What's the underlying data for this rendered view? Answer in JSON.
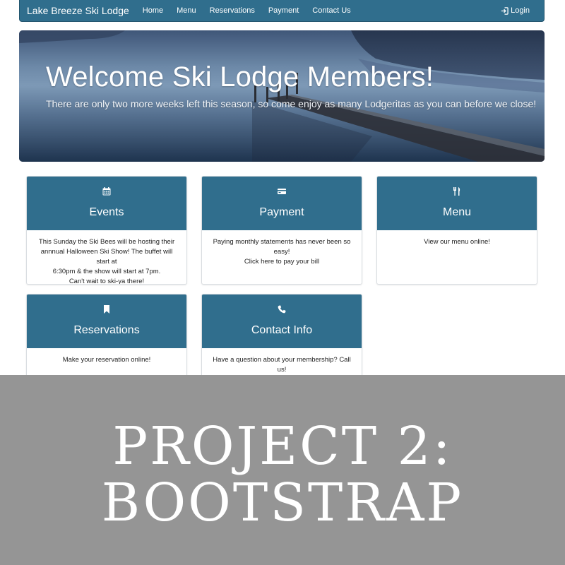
{
  "navbar": {
    "brand": "Lake Breeze Ski Lodge",
    "links": [
      "Home",
      "Menu",
      "Reservations",
      "Payment",
      "Contact Us"
    ],
    "login_label": "Login",
    "color": "#306e8d"
  },
  "hero": {
    "title": "Welcome Ski Lodge Members!",
    "subtitle": "There are only two more weeks left this season, so come enjoy as many Lodgeritas as you can before we close!"
  },
  "cards": [
    {
      "icon": "calendar-icon",
      "title": "Events",
      "lines": [
        "This Sunday the Ski Bees will be hosting their",
        "annnual Halloween Ski Show! The buffet will start at",
        "6:30pm & the show will start at 7pm.",
        "Can't wait to ski-ya there!"
      ]
    },
    {
      "icon": "credit-card-icon",
      "title": "Payment",
      "lines": [
        "Paying monthly statements has never been so easy!",
        "Click here to pay your bill"
      ]
    },
    {
      "icon": "cutlery-icon",
      "title": "Menu",
      "lines": [
        "View our menu online!"
      ]
    },
    {
      "icon": "bookmark-icon",
      "title": "Reservations",
      "lines": [
        "Make your reservation online!"
      ]
    },
    {
      "icon": "phone-icon",
      "title": "Contact Info",
      "lines": [
        "Have a question about your membership? Call us!"
      ]
    }
  ],
  "banner": {
    "line1": "PROJECT 2:",
    "line2": "BOOTSTRAP",
    "background": "#959595"
  }
}
